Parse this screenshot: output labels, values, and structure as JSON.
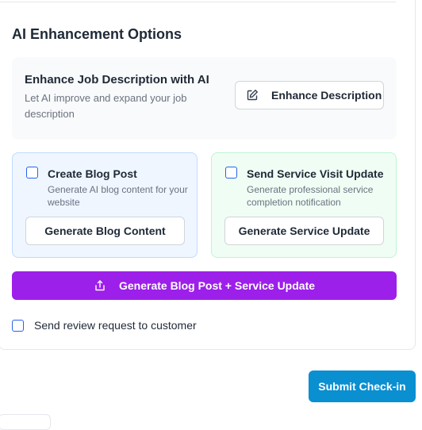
{
  "ai_section": {
    "title": "AI Enhancement Options",
    "enhance": {
      "title": "Enhance Job Description with AI",
      "description": "Let AI improve and expand your job description",
      "button_label": "Enhance Description",
      "button_icon": "edit-icon"
    },
    "blog": {
      "title": "Create Blog Post",
      "description": "Generate AI blog content for your website",
      "button_label": "Generate Blog Content",
      "checked": false
    },
    "service": {
      "title": "Send Service Visit Update",
      "description": "Generate professional service completion notification",
      "button_label": "Generate Service Update",
      "checked": false
    },
    "combined": {
      "button_label": "Generate Blog Post + Service Update",
      "button_icon": "share-upload-icon"
    },
    "review": {
      "label": "Send review request to customer",
      "checked": false
    }
  },
  "footer": {
    "submit_label": "Submit Check-in"
  },
  "colors": {
    "accent_blue": "#2563eb",
    "purple_button": "#9d1fea",
    "submit_button": "#0a8fd1",
    "blog_bg": "#eff6ff",
    "service_bg": "#f0fdf4"
  }
}
